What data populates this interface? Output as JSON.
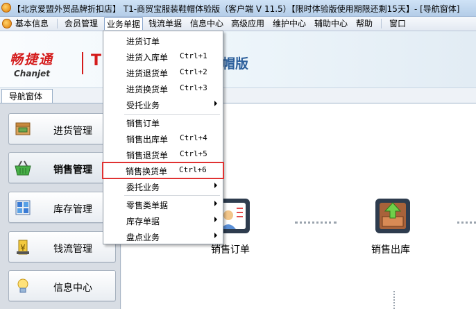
{
  "window": {
    "title": "【北京爱盟外贸品牌折扣店】 T1-商贸宝服装鞋帽体验版（客户端 V 11.5）【限时体验版使用期限还剩15天】- [导航窗体]"
  },
  "menubar": {
    "items": [
      "基本信息",
      "会员管理",
      "业务单据",
      "钱流单据",
      "信息中心",
      "高级应用",
      "维护中心",
      "辅助中心",
      "帮助",
      "窗口"
    ],
    "active": "业务单据"
  },
  "banner": {
    "logo_cn": "畅捷通",
    "logo_en": "Chanjet",
    "logo_t": "T",
    "edition": "帽版"
  },
  "nav_tab": {
    "label": "导航窗体"
  },
  "sidebar": {
    "items": [
      {
        "label": "进货管理"
      },
      {
        "label": "销售管理"
      },
      {
        "label": "库存管理"
      },
      {
        "label": "钱流管理"
      },
      {
        "label": "信息中心"
      }
    ],
    "selected": "销售管理"
  },
  "dropdown": {
    "items": [
      {
        "label": "进货订单",
        "shortcut": "",
        "submenu": false
      },
      {
        "label": "进货入库单",
        "shortcut": "Ctrl+1",
        "submenu": false
      },
      {
        "label": "进货退货单",
        "shortcut": "Ctrl+2",
        "submenu": false
      },
      {
        "label": "进货换货单",
        "shortcut": "Ctrl+3",
        "submenu": false
      },
      {
        "label": "受托业务",
        "shortcut": "",
        "submenu": true
      },
      {
        "label": "销售订单",
        "shortcut": "",
        "submenu": false
      },
      {
        "label": "销售出库单",
        "shortcut": "Ctrl+4",
        "submenu": false
      },
      {
        "label": "销售退货单",
        "shortcut": "Ctrl+5",
        "submenu": false
      },
      {
        "label": "销售换货单",
        "shortcut": "Ctrl+6",
        "submenu": false
      },
      {
        "label": "委托业务",
        "shortcut": "",
        "submenu": true
      },
      {
        "label": "零售类单据",
        "shortcut": "",
        "submenu": true
      },
      {
        "label": "库存单据",
        "shortcut": "",
        "submenu": true
      },
      {
        "label": "盘点业务",
        "shortcut": "",
        "submenu": true
      }
    ],
    "highlighted": "销售换货单"
  },
  "content": {
    "nodes": [
      {
        "label": "销售订单",
        "icon": "sales-order-icon"
      },
      {
        "label": "销售出库",
        "icon": "sales-outbound-icon"
      }
    ]
  },
  "colors": {
    "highlight_border": "#e03232",
    "logo_red": "#d41b1b",
    "edition_blue": "#2c5f9b"
  }
}
